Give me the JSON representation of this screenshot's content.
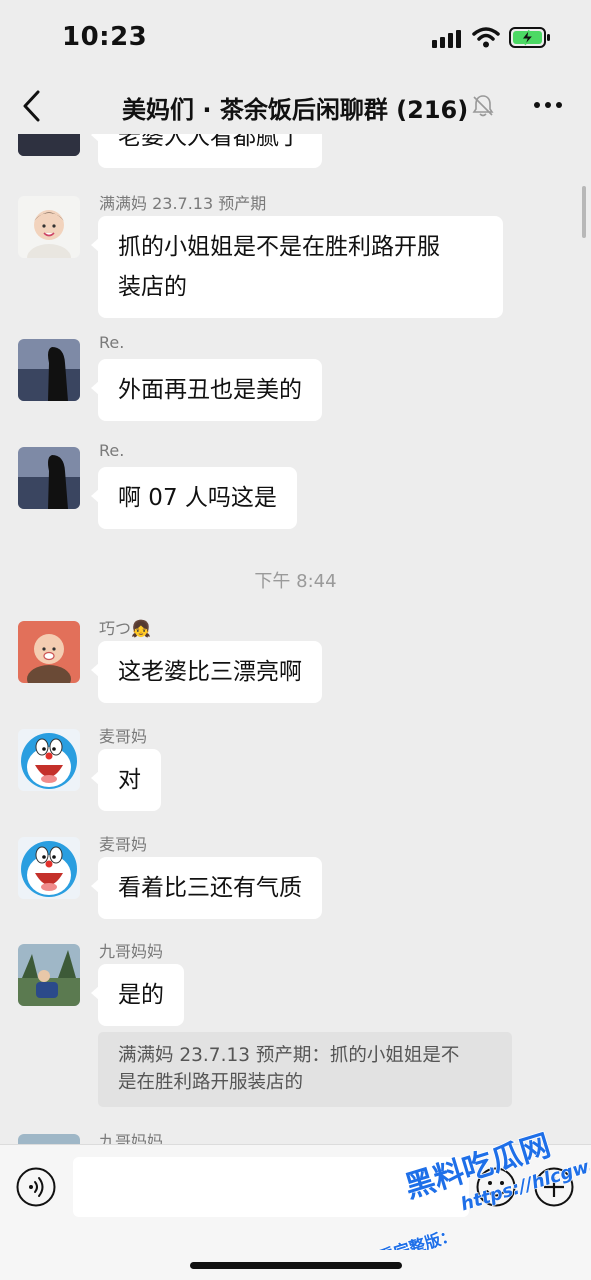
{
  "status_bar": {
    "time": "10:23"
  },
  "nav": {
    "title": "美妈们 · 茶余饭后闲聊群 (216)"
  },
  "chat": {
    "partial_top_text": "老婆人人看都腻了",
    "messages": [
      {
        "sender": "满满妈 23.7.13 预产期",
        "lines": [
          "抓的小姐姐是不是在胜利路开服",
          "装店的"
        ]
      },
      {
        "sender": "Re.",
        "text": "外面再丑也是美的"
      },
      {
        "sender": "Re.",
        "text": "啊 07 人吗这是"
      },
      {
        "sender": "巧つ👧",
        "text": "这老婆比三漂亮啊"
      },
      {
        "sender": "麦哥妈",
        "text": "对"
      },
      {
        "sender": "麦哥妈",
        "text": "看着比三还有气质"
      },
      {
        "sender": "九哥妈妈",
        "text": "是的"
      },
      {
        "sender": "九哥妈妈"
      }
    ],
    "time_separator": "下午 8:44",
    "quote_lines": [
      "满满妈 23.7.13 预产期：抓的小姐姐是不",
      "是在胜利路开服装店的"
    ]
  },
  "input_bar": {
    "placeholder": ""
  },
  "watermark": {
    "line1": "黑料吃瓜网",
    "line2": "https://hlcgw.co",
    "line3": "看完整版："
  },
  "colors": {
    "background": "#ededed",
    "bubble": "#ffffff",
    "battery": "#4cd964",
    "doraemon": "#2a9ee0"
  }
}
